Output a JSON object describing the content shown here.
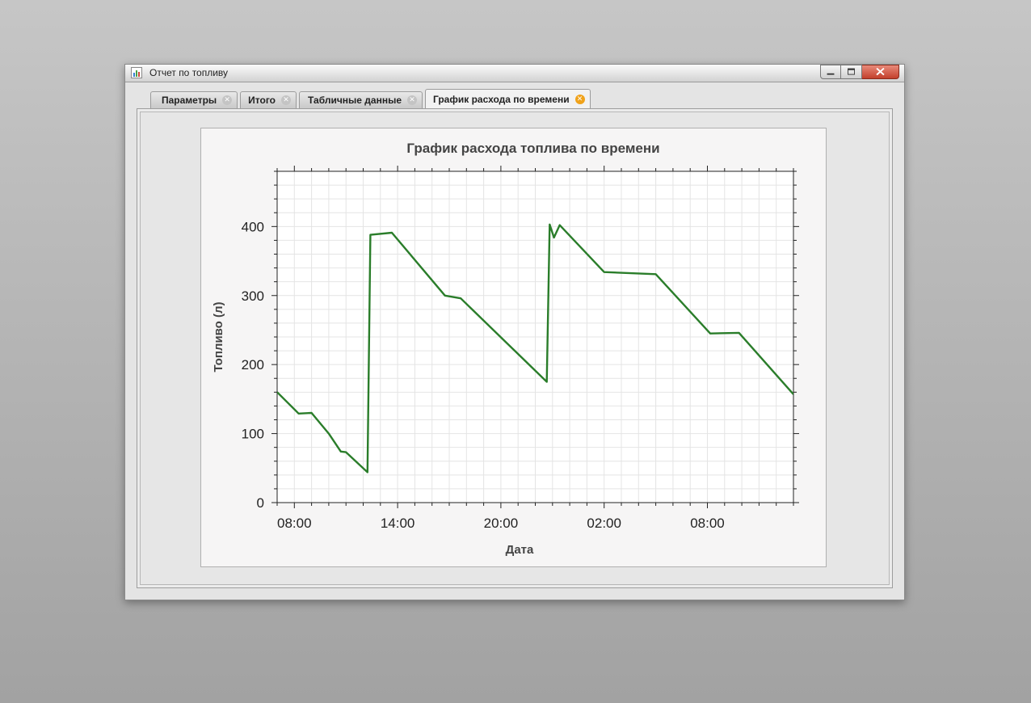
{
  "window": {
    "title": "Отчет по топливу"
  },
  "tabs": [
    {
      "label": "Параметры",
      "active": false
    },
    {
      "label": "Итого",
      "active": false
    },
    {
      "label": "Табличные данные",
      "active": false
    },
    {
      "label": "График расхода по времени",
      "active": true
    }
  ],
  "colors": {
    "series": "#2a7d2a",
    "active_tab_close": "#f0a21a",
    "close_button": "#c3402c"
  },
  "chart_data": {
    "type": "line",
    "title": "График расхода топлива по времени",
    "xlabel": "Дата",
    "ylabel": "Топливо (л)",
    "x_tick_labels": [
      "08:00",
      "14:00",
      "20:00",
      "02:00",
      "08:00"
    ],
    "y_tick_labels": [
      "0",
      "100",
      "200",
      "300",
      "400"
    ],
    "xlim_hours": [
      7.0,
      37.0
    ],
    "ylim": [
      0,
      480
    ],
    "grid": true,
    "series": [
      {
        "points": [
          {
            "x": "07:00",
            "y": 160
          },
          {
            "x": "08:15",
            "y": 129
          },
          {
            "x": "09:00",
            "y": 130
          },
          {
            "x": "10:00",
            "y": 100
          },
          {
            "x": "10:42",
            "y": 74
          },
          {
            "x": "11:00",
            "y": 73
          },
          {
            "x": "12:15",
            "y": 44
          },
          {
            "x": "12:25",
            "y": 388
          },
          {
            "x": "13:40",
            "y": 391
          },
          {
            "x": "16:45",
            "y": 300
          },
          {
            "x": "17:40",
            "y": 296
          },
          {
            "x": "22:40",
            "y": 175
          },
          {
            "x": "22:50",
            "y": 403
          },
          {
            "x": "23:05",
            "y": 384
          },
          {
            "x": "23:25",
            "y": 402
          },
          {
            "x": "02:00",
            "y": 334
          },
          {
            "x": "05:00",
            "y": 331
          },
          {
            "x": "08:10",
            "y": 245
          },
          {
            "x": "09:50",
            "y": 246
          },
          {
            "x": "13:00",
            "y": 157
          }
        ]
      }
    ]
  }
}
